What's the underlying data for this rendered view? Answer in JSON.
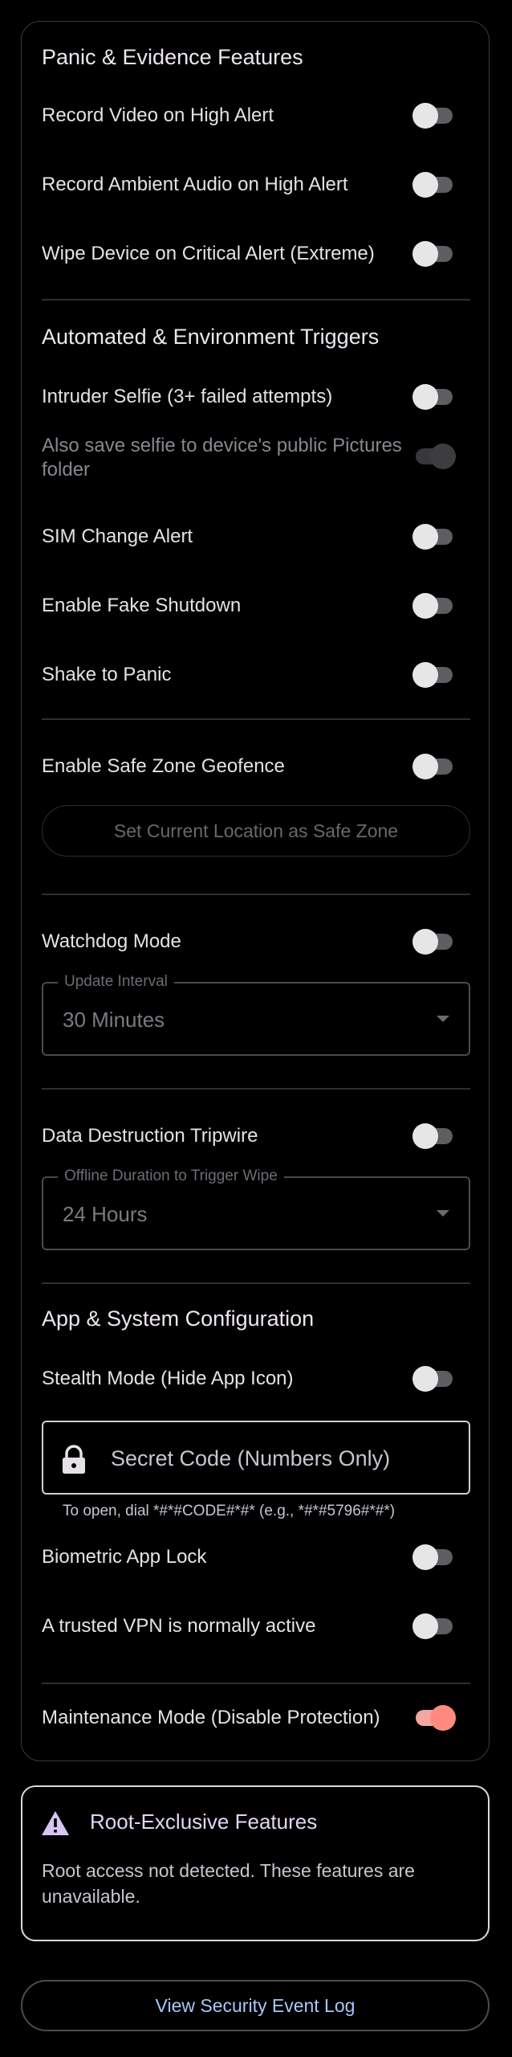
{
  "panic": {
    "title": "Panic & Evidence Features",
    "record_video": "Record Video on High Alert",
    "record_audio": "Record Ambient Audio on High Alert",
    "wipe_device": "Wipe Device on Critical Alert (Extreme)"
  },
  "automated": {
    "title": "Automated & Environment Triggers",
    "intruder_selfie": "Intruder Selfie (3+ failed attempts)",
    "save_selfie": "Also save selfie to device's public Pictures folder",
    "sim_change": "SIM Change Alert",
    "fake_shutdown": "Enable Fake Shutdown",
    "shake_to_panic": "Shake to Panic"
  },
  "geofence": {
    "label": "Enable Safe Zone Geofence",
    "button": "Set Current Location as Safe Zone"
  },
  "watchdog": {
    "label": "Watchdog Mode",
    "interval_legend": "Update Interval",
    "interval_value": "30 Minutes"
  },
  "tripwire": {
    "label": "Data Destruction Tripwire",
    "duration_legend": "Offline Duration to Trigger Wipe",
    "duration_value": "24 Hours"
  },
  "config": {
    "title": "App & System Configuration",
    "stealth": "Stealth Mode (Hide App Icon)",
    "secret_placeholder": "Secret Code (Numbers Only)",
    "secret_helper": "To open, dial *#*#CODE#*#* (e.g., *#*#5796#*#*)",
    "biometric": "Biometric App Lock",
    "vpn": "A trusted VPN is normally active",
    "maintenance": "Maintenance Mode (Disable Protection)"
  },
  "root": {
    "title": "Root-Exclusive Features",
    "body": "Root access not detected. These features are unavailable."
  },
  "footer": {
    "view_log": "View Security Event Log"
  },
  "colors": {
    "background": "#000000",
    "switch_on": "#ff8a80",
    "link": "#a8c7fa"
  }
}
